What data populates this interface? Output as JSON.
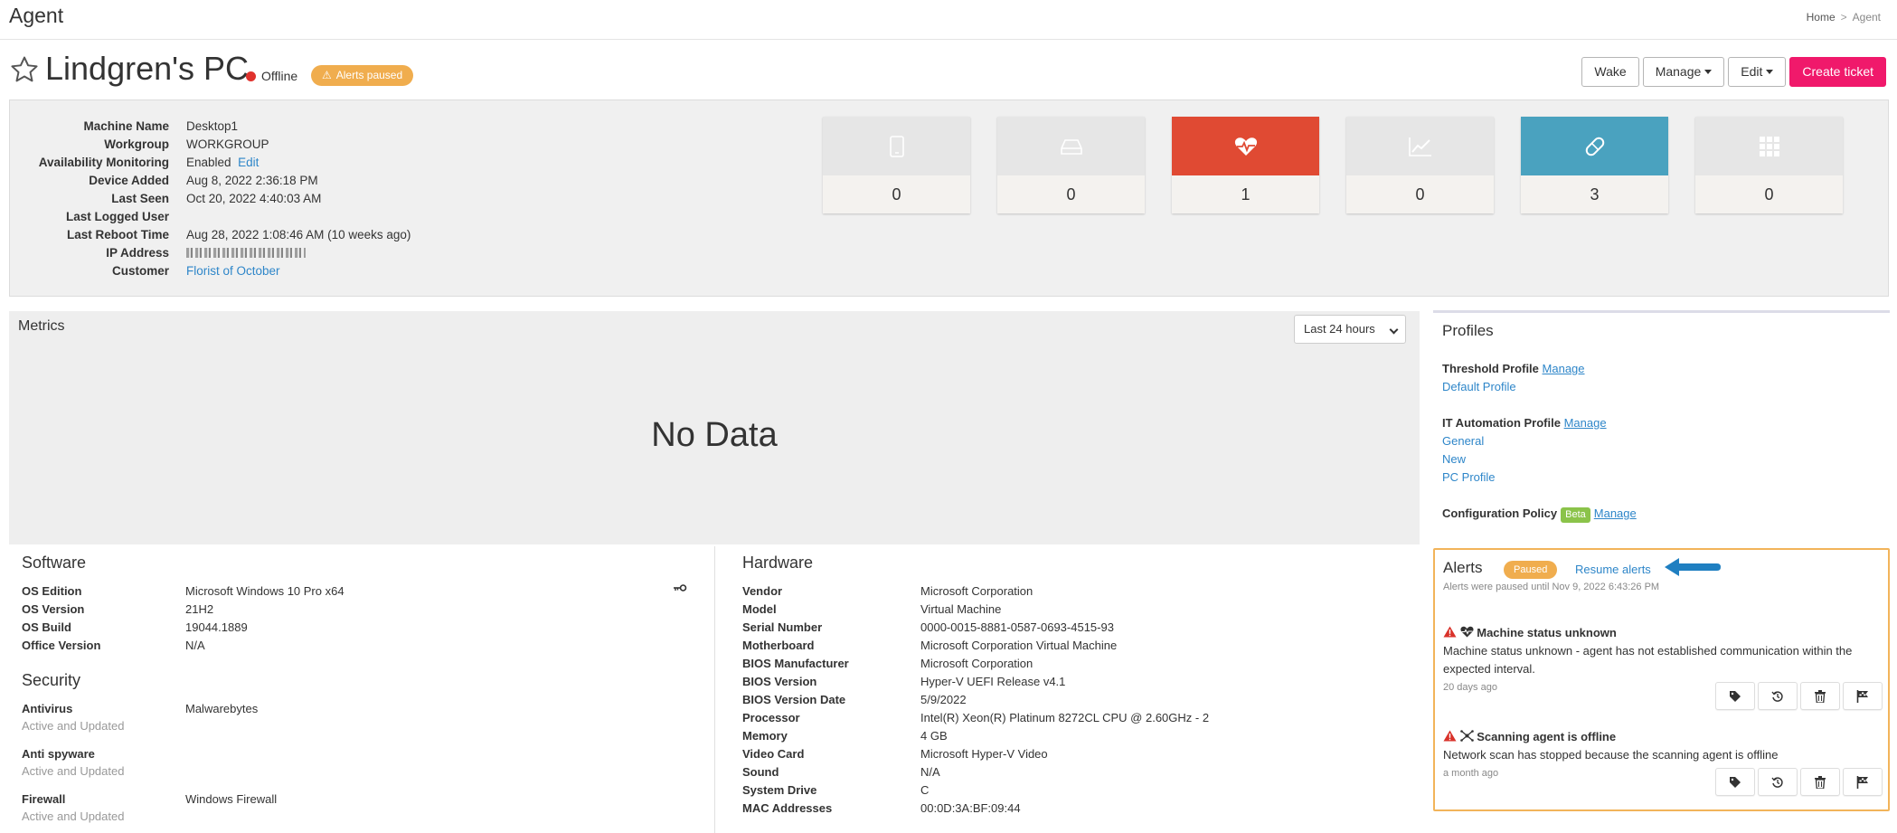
{
  "app": {
    "title": "Agent"
  },
  "breadcrumb": {
    "home": "Home",
    "current": "Agent"
  },
  "device": {
    "name": "Lindgren's PC",
    "status": "Offline",
    "alerts_badge": "Alerts paused"
  },
  "actions": {
    "wake": "Wake",
    "manage": "Manage",
    "edit": "Edit",
    "create_ticket": "Create ticket"
  },
  "info": {
    "machine_name": {
      "label": "Machine Name",
      "value": "Desktop1"
    },
    "workgroup": {
      "label": "Workgroup",
      "value": "WORKGROUP"
    },
    "availability": {
      "label": "Availability Monitoring",
      "value": "Enabled",
      "link": "Edit"
    },
    "device_added": {
      "label": "Device Added",
      "value": "Aug 8, 2022 2:36:18 PM"
    },
    "last_seen": {
      "label": "Last Seen",
      "value": "Oct 20, 2022 4:40:03 AM"
    },
    "last_logged_user": {
      "label": "Last Logged User",
      "value": ""
    },
    "last_reboot": {
      "label": "Last Reboot Time",
      "value": "Aug 28, 2022 1:08:46 AM (10 weeks ago)"
    },
    "ip_address": {
      "label": "IP Address"
    },
    "customer": {
      "label": "Customer",
      "value": "Florist of October"
    }
  },
  "tiles": [
    {
      "icon": "phone-icon",
      "count": "0",
      "color": "#e6e6e6"
    },
    {
      "icon": "hard-drive-icon",
      "count": "0",
      "color": "#e6e6e6"
    },
    {
      "icon": "heartbeat-icon",
      "count": "1",
      "color": "#e04a33"
    },
    {
      "icon": "line-chart-icon",
      "count": "0",
      "color": "#e6e6e6"
    },
    {
      "icon": "patch-icon",
      "count": "3",
      "color": "#4aa2bf"
    },
    {
      "icon": "grid-icon",
      "count": "0",
      "color": "#e6e6e6"
    }
  ],
  "metrics": {
    "title": "Metrics",
    "range": "Last 24 hours",
    "empty_text": "No Data"
  },
  "software": {
    "title": "Software",
    "rows": [
      {
        "label": "OS Edition",
        "value": "Microsoft Windows 10 Pro x64"
      },
      {
        "label": "OS Version",
        "value": "21H2"
      },
      {
        "label": "OS Build",
        "value": "19044.1889"
      },
      {
        "label": "Office Version",
        "value": "N/A"
      }
    ]
  },
  "security": {
    "title": "Security",
    "rows": [
      {
        "label": "Antivirus",
        "value": "Malwarebytes",
        "sub": "Active and Updated"
      },
      {
        "label": "Anti spyware",
        "value": "",
        "sub": "Active and Updated"
      },
      {
        "label": "Firewall",
        "value": "Windows Firewall",
        "sub": "Active and Updated"
      }
    ]
  },
  "hardware": {
    "title": "Hardware",
    "rows": [
      {
        "label": "Vendor",
        "value": "Microsoft Corporation"
      },
      {
        "label": "Model",
        "value": "Virtual Machine"
      },
      {
        "label": "Serial Number",
        "value": "0000-0015-8881-0587-0693-4515-93"
      },
      {
        "label": "Motherboard",
        "value": "Microsoft Corporation Virtual Machine"
      },
      {
        "label": "BIOS Manufacturer",
        "value": "Microsoft Corporation"
      },
      {
        "label": "BIOS Version",
        "value": "Hyper-V UEFI Release v4.1"
      },
      {
        "label": "BIOS Version Date",
        "value": "5/9/2022"
      },
      {
        "label": "Processor",
        "value": "Intel(R) Xeon(R) Platinum 8272CL CPU @ 2.60GHz - 2"
      },
      {
        "label": "Memory",
        "value": "4 GB"
      },
      {
        "label": "Video Card",
        "value": "Microsoft Hyper-V Video"
      },
      {
        "label": "Sound",
        "value": "N/A"
      },
      {
        "label": "System Drive",
        "value": "C"
      },
      {
        "label": "MAC Addresses",
        "value": "00:0D:3A:BF:09:44"
      }
    ]
  },
  "profiles": {
    "title": "Profiles",
    "threshold_label": "Threshold Profile",
    "threshold_manage": "Manage",
    "threshold_items": [
      "Default Profile"
    ],
    "automation_label": "IT Automation Profile",
    "automation_manage": "Manage",
    "automation_items": [
      "General",
      "New",
      "PC Profile"
    ],
    "config_label": "Configuration Policy",
    "config_badge": "Beta",
    "config_manage": "Manage"
  },
  "alerts": {
    "title": "Alerts",
    "badge": "Paused",
    "resume": "Resume alerts",
    "note": "Alerts were paused until Nov 9, 2022 6:43:26 PM",
    "items": [
      {
        "title": "Machine status unknown",
        "desc": "Machine status unknown - agent has not established communication within the expected interval.",
        "age": "20 days ago"
      },
      {
        "title": "Scanning agent is offline",
        "desc": "Network scan has stopped because the scanning agent is offline",
        "age": "a month ago"
      }
    ]
  }
}
